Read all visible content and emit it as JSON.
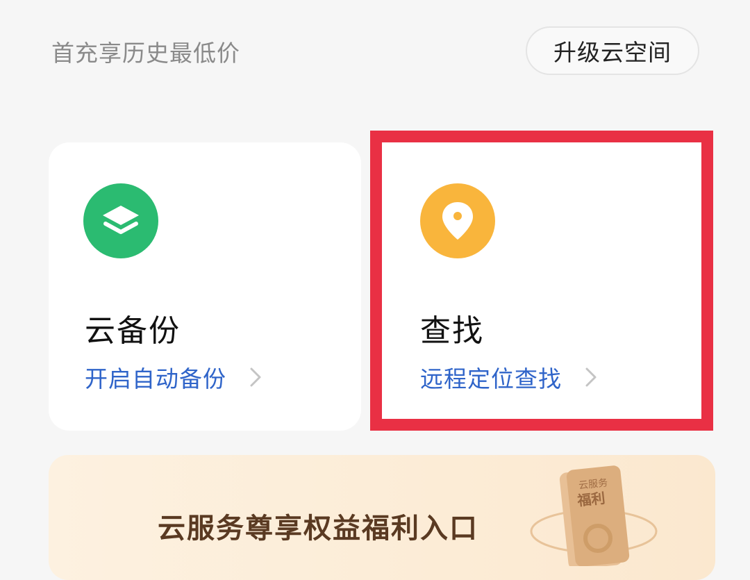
{
  "header": {
    "promo_text": "首充享历史最低价",
    "upgrade_label": "升级云空间"
  },
  "cards": [
    {
      "title": "云备份",
      "link": "开启自动备份",
      "icon": "layers-icon",
      "icon_color": "#2bbb71"
    },
    {
      "title": "查找",
      "link": "远程定位查找",
      "icon": "location-pin-icon",
      "icon_color": "#f9b53c"
    }
  ],
  "banner": {
    "text": "云服务尊享权益福利入口",
    "coupon_label_top": "云服务",
    "coupon_label_bottom": "福利"
  },
  "colors": {
    "link": "#2f64c9",
    "highlight_border": "#e93044"
  }
}
